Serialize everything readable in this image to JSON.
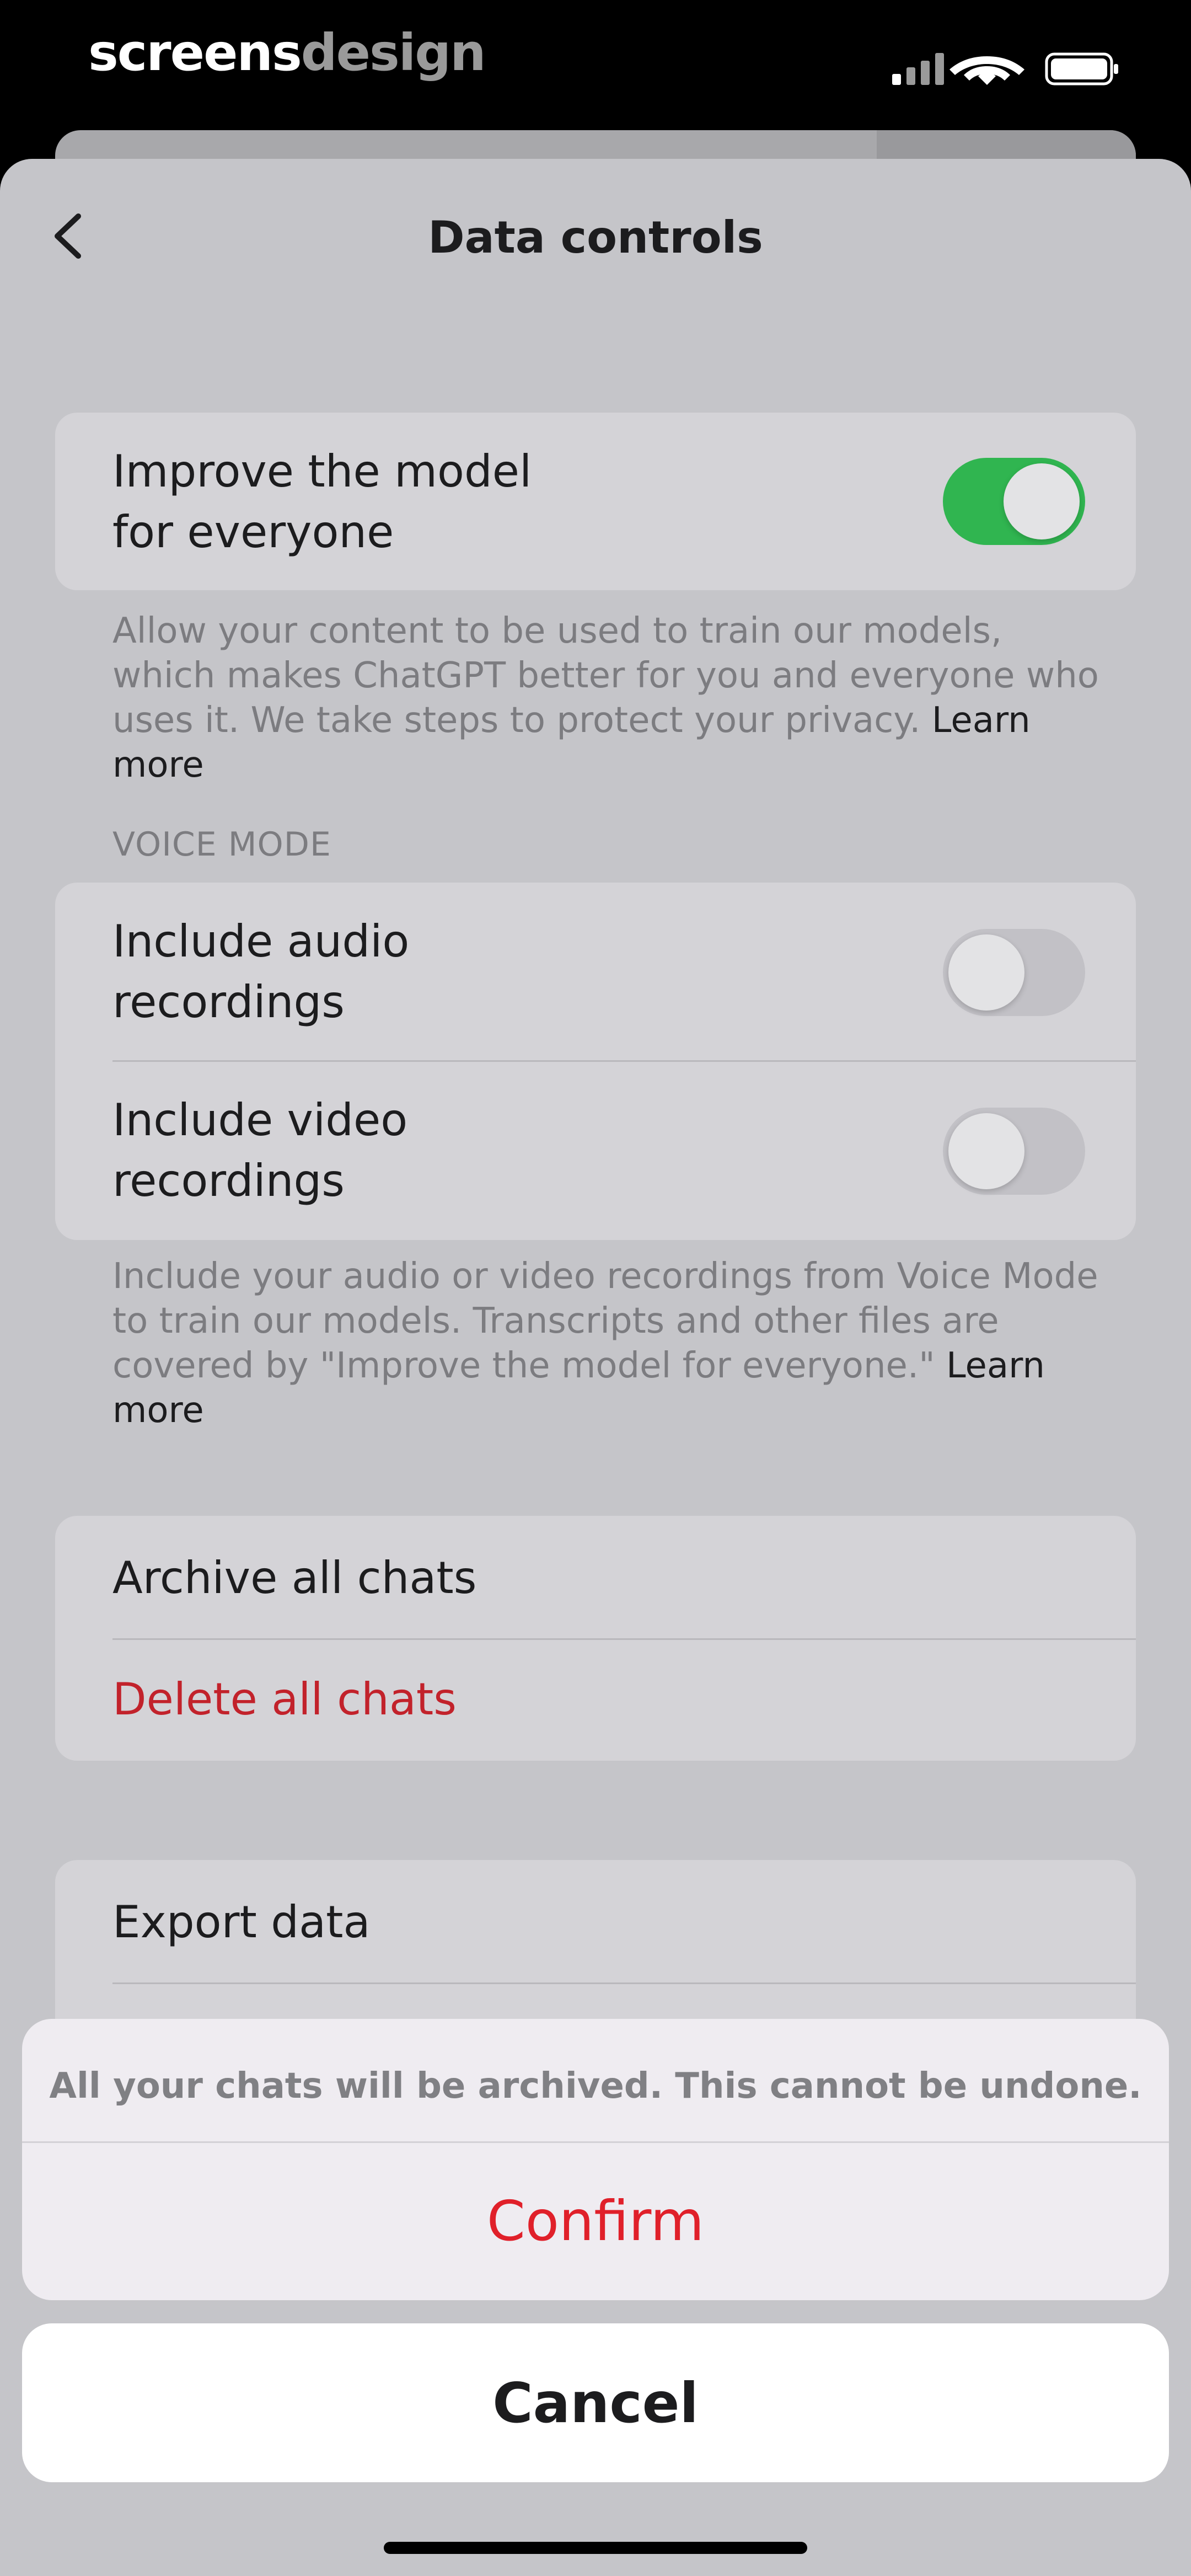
{
  "watermark": {
    "part1": "screens",
    "part2": "design"
  },
  "nav": {
    "title": "Data controls"
  },
  "improve": {
    "label_line1": "Improve the model",
    "label_line2": "for everyone",
    "enabled": true,
    "footnote": "Allow your content to be used to train our models, which makes ChatGPT better for you and everyone who uses it. We take steps to protect your privacy.",
    "link": "Learn more"
  },
  "voice": {
    "header": "VOICE MODE",
    "audio": {
      "line1": "Include audio",
      "line2": "recordings",
      "enabled": false
    },
    "video": {
      "line1": "Include video",
      "line2": "recordings",
      "enabled": false
    },
    "footnote": "Include your audio or video recordings from Voice Mode to train our models. Transcripts and other files are covered by \"Improve the model for everyone.\"",
    "link": "Learn more"
  },
  "chats": {
    "archive": "Archive all chats",
    "delete": "Delete all chats"
  },
  "export": {
    "label": "Export data"
  },
  "action_sheet": {
    "message": "All your chats will be archived. This cannot be undone.",
    "confirm": "Confirm",
    "cancel": "Cancel"
  },
  "colors": {
    "toggle_on": "#30b550",
    "destructive": "#e0202a",
    "delete_text": "#c2222b"
  }
}
